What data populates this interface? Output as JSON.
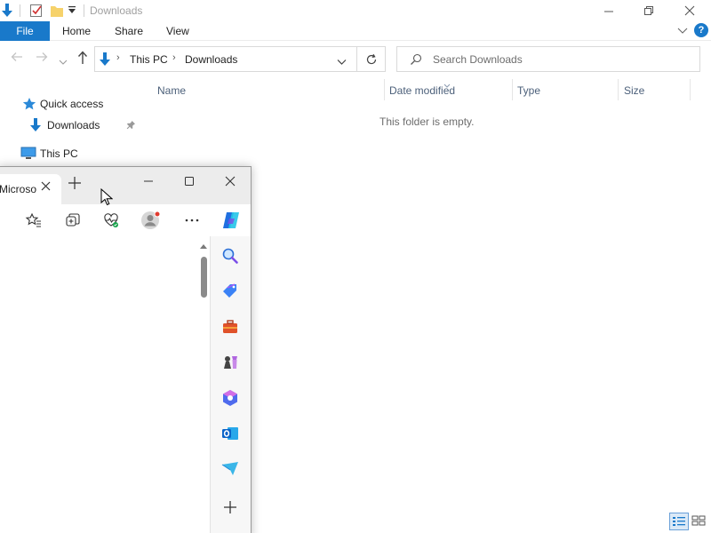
{
  "explorer": {
    "title": "Downloads",
    "ribbon": {
      "file_label": "File",
      "home_label": "Home",
      "share_label": "Share",
      "view_label": "View",
      "help_label": "?"
    },
    "address": {
      "part1": "This PC",
      "part2": "Downloads"
    },
    "search": {
      "placeholder": "Search Downloads"
    },
    "nav_pane": {
      "quick_access": "Quick access",
      "downloads": "Downloads",
      "this_pc": "This PC"
    },
    "columns": {
      "name": "Name",
      "date_modified": "Date modified",
      "type": "Type",
      "size": "Size"
    },
    "empty_message": "This folder is empty.",
    "colors": {
      "accent": "#1979ca",
      "column_header": "#4c607a"
    }
  },
  "edge": {
    "tab_title": "Microsoft",
    "icons": {
      "toolbar": [
        "favorites-icon",
        "collections-icon",
        "browser-essentials-icon",
        "profile-icon",
        "more-icon",
        "copilot-icon"
      ],
      "sidebar": [
        "search-icon",
        "shopping-icon",
        "tools-icon",
        "games-icon",
        "microsoft-365-icon",
        "outlook-icon",
        "drop-icon",
        "add-icon"
      ]
    }
  }
}
